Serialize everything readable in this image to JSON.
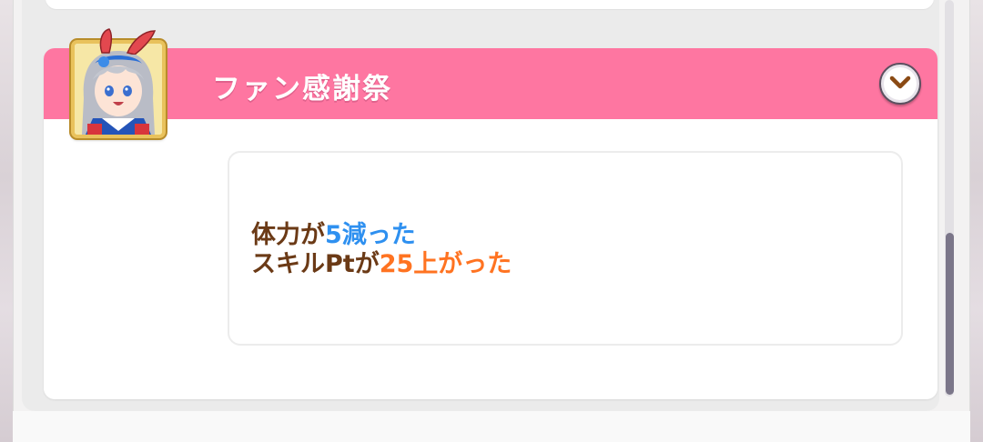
{
  "event": {
    "title": "ファン感謝祭",
    "toggle_icon": "chevron-down-icon",
    "avatar_icon": "character-portrait-icon"
  },
  "result": {
    "line1": {
      "prefix": "体力が",
      "highlight": "5減った"
    },
    "line2": {
      "prefix": "スキルPtが",
      "highlight": "25上がった"
    }
  },
  "colors": {
    "header": "#fe76a1",
    "text_brown": "#6b3a16",
    "decrease_blue": "#2e90f0",
    "increase_orange": "#ff7321",
    "avatar_frame": "#e9c25c"
  },
  "scroll": {
    "position": 0.85
  }
}
